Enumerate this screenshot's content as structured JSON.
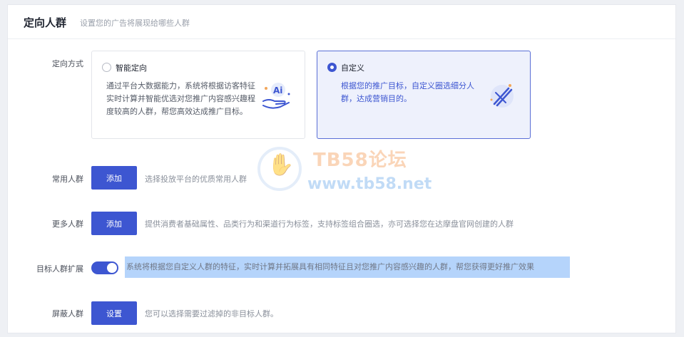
{
  "header": {
    "title": "定向人群",
    "subtitle": "设置您的广告将展现给哪些人群"
  },
  "targeting": {
    "label": "定向方式",
    "smart": {
      "title": "智能定向",
      "desc": "通过平台大数据能力，系统将根据访客特征实时计算并智能优选对您推广内容感兴趣程度较高的人群，帮您高效达成推广目标。",
      "selected": false
    },
    "custom": {
      "title": "自定义",
      "desc": "根据您的推广目标，自定义圈选细分人群，达成营销目的。",
      "selected": true
    }
  },
  "common": {
    "label": "常用人群",
    "button": "添加",
    "hint": "选择投放平台的优质常用人群"
  },
  "more": {
    "label": "更多人群",
    "button": "添加",
    "hint": "提供消费者基础属性、品类行为和渠道行为标签，支持标签组合圈选，亦可选择您在达摩盘官网创建的人群"
  },
  "expand": {
    "label": "目标人群扩展",
    "enabled": true,
    "hint": "系统将根据您自定义人群的特征，实时计算并拓展具有相同特征且对您推广内容感兴趣的人群，帮您获得更好推广效果"
  },
  "block": {
    "label": "屏蔽人群",
    "button": "设置",
    "hint": "您可以选择需要过滤掉的非目标人群。"
  },
  "watermark": {
    "title": "TB58论坛",
    "url": "www.tb58.net"
  },
  "colors": {
    "accent": "#3d56d1",
    "highlight": "#b5d4fb"
  }
}
